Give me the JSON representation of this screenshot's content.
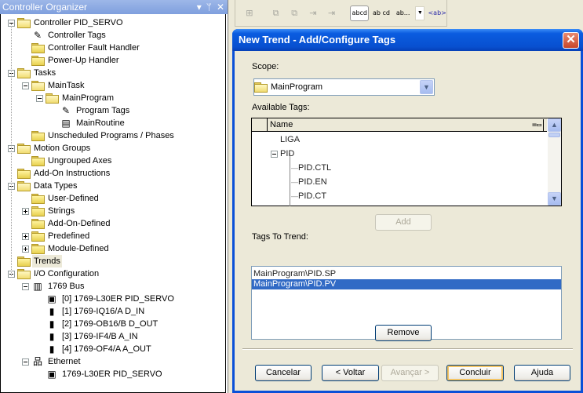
{
  "organizer": {
    "title": "Controller Organizer",
    "controls": {
      "dropdown": "▾",
      "pin": "ᛘ",
      "close": "✕"
    },
    "tree": [
      {
        "label": "Controller PID_SERVO",
        "icon": "folder-open-icon",
        "depth": 0,
        "expander": "minus"
      },
      {
        "label": "Controller Tags",
        "icon": "tags-icon",
        "depth": 1
      },
      {
        "label": "Controller Fault Handler",
        "icon": "folder-icon",
        "depth": 1
      },
      {
        "label": "Power-Up Handler",
        "icon": "folder-icon",
        "depth": 1
      },
      {
        "label": "Tasks",
        "icon": "folder-open-icon",
        "depth": 0,
        "expander": "minus"
      },
      {
        "label": "MainTask",
        "icon": "task-icon",
        "depth": 1,
        "expander": "minus"
      },
      {
        "label": "MainProgram",
        "icon": "program-icon",
        "depth": 2,
        "expander": "minus"
      },
      {
        "label": "Program Tags",
        "icon": "tags-icon",
        "depth": 3
      },
      {
        "label": "MainRoutine",
        "icon": "routine-icon",
        "depth": 3
      },
      {
        "label": "Unscheduled Programs / Phases",
        "icon": "folder-icon",
        "depth": 1
      },
      {
        "label": "Motion Groups",
        "icon": "folder-open-icon",
        "depth": 0,
        "expander": "minus"
      },
      {
        "label": "Ungrouped Axes",
        "icon": "folder-icon",
        "depth": 1
      },
      {
        "label": "Add-On Instructions",
        "icon": "folder-icon",
        "depth": 0
      },
      {
        "label": "Data Types",
        "icon": "folder-open-icon",
        "depth": 0,
        "expander": "minus"
      },
      {
        "label": "User-Defined",
        "icon": "datatype-folder-icon",
        "depth": 1
      },
      {
        "label": "Strings",
        "icon": "datatype-folder-icon",
        "depth": 1,
        "expander": "plus"
      },
      {
        "label": "Add-On-Defined",
        "icon": "datatype-folder-icon",
        "depth": 1
      },
      {
        "label": "Predefined",
        "icon": "datatype-folder-icon",
        "depth": 1,
        "expander": "plus"
      },
      {
        "label": "Module-Defined",
        "icon": "datatype-folder-icon",
        "depth": 1,
        "expander": "plus"
      },
      {
        "label": "Trends",
        "icon": "folder-icon",
        "depth": 0,
        "selected": true
      },
      {
        "label": "I/O Configuration",
        "icon": "folder-open-icon",
        "depth": 0,
        "expander": "minus"
      },
      {
        "label": "1769 Bus",
        "icon": "bus-icon",
        "depth": 1,
        "expander": "minus"
      },
      {
        "label": "[0] 1769-L30ER PID_SERVO",
        "icon": "controller-module-icon",
        "depth": 2
      },
      {
        "label": "[1] 1769-IQ16/A D_IN",
        "icon": "io-module-icon",
        "depth": 2
      },
      {
        "label": "[2] 1769-OB16/B D_OUT",
        "icon": "io-module-icon",
        "depth": 2
      },
      {
        "label": "[3] 1769-IF4/B A_IN",
        "icon": "io-module-icon",
        "depth": 2
      },
      {
        "label": "[4] 1769-OF4/A A_OUT",
        "icon": "io-module-icon",
        "depth": 2
      },
      {
        "label": "Ethernet",
        "icon": "network-icon",
        "depth": 1,
        "expander": "minus"
      },
      {
        "label": "1769-L30ER PID_SERVO",
        "icon": "controller-module-icon",
        "depth": 2
      }
    ]
  },
  "toolbar": {
    "buttons": [
      {
        "name": "toolbar-btn-1",
        "glyph": "⊞",
        "type": "icon"
      },
      {
        "name": "toolbar-btn-2",
        "glyph": "⧉",
        "type": "icon"
      },
      {
        "name": "toolbar-btn-3",
        "glyph": "⧉",
        "type": "icon"
      },
      {
        "name": "toolbar-btn-4",
        "glyph": "⇥",
        "type": "icon"
      },
      {
        "name": "toolbar-btn-5",
        "glyph": "⇥",
        "type": "icon"
      },
      {
        "name": "text-wrap-abcd",
        "glyph": "abcd",
        "type": "txt",
        "active": true
      },
      {
        "name": "text-wrap-abcd-lines",
        "glyph": "ab cd",
        "type": "txt"
      },
      {
        "name": "text-truncate",
        "glyph": "ab...",
        "type": "txt"
      },
      {
        "name": "text-tag",
        "glyph": "<ab>",
        "type": "txt",
        "blue": true
      }
    ]
  },
  "dialog": {
    "title": "New Trend - Add/Configure Tags",
    "close_glyph": "✕",
    "scope_label": "Scope:",
    "scope_value": "MainProgram",
    "available_label": "Available Tags:",
    "grid_header": "Name",
    "grid_header_icon": "=▭",
    "available_tags": [
      {
        "label": "LIGA",
        "indent": 1
      },
      {
        "label": "PID",
        "indent": 0,
        "expander": true
      },
      {
        "label": "PID.CTL",
        "indent": 2
      },
      {
        "label": "PID.EN",
        "indent": 2
      },
      {
        "label": "PID.CT",
        "indent": 2
      }
    ],
    "add_button": "Add",
    "tags_to_trend_label": "Tags To Trend:",
    "tags_to_trend": [
      {
        "label": "MainProgram\\PID.SP",
        "selected": false
      },
      {
        "label": "MainProgram\\PID.PV",
        "selected": true
      }
    ],
    "remove_button": "Remove",
    "buttons": {
      "cancel": "Cancelar",
      "back": "< Voltar",
      "next": "Avançar >",
      "finish": "Concluir",
      "help": "Ajuda"
    }
  }
}
